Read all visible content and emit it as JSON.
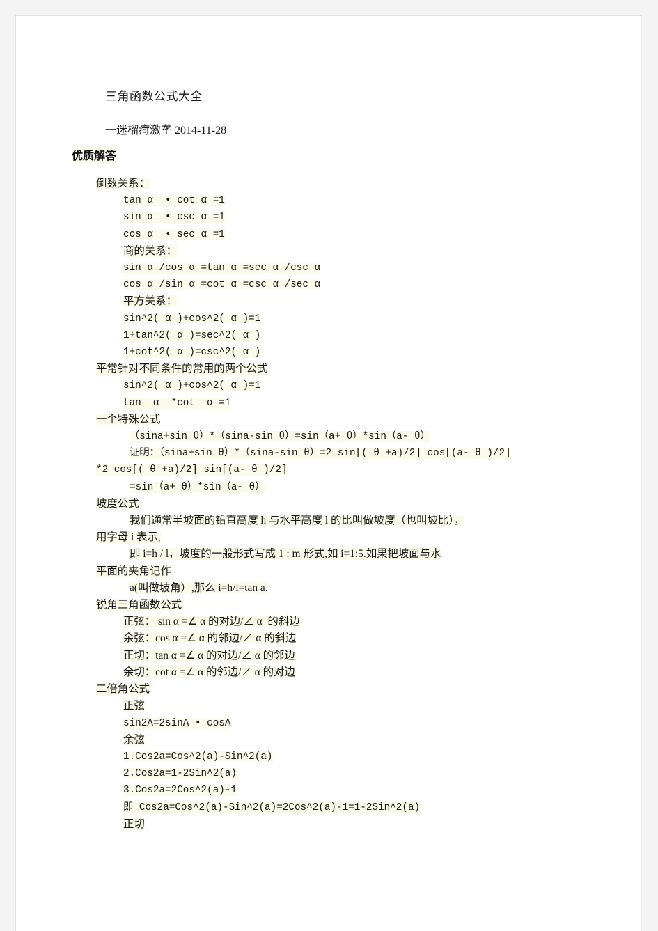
{
  "document": {
    "title": "三角函数公式大全",
    "byline": "一迷榴疴激垄 2014-11-28",
    "answer_heading": "优质解答"
  },
  "content": {
    "lines": [
      {
        "text": "倒数关系：",
        "style": "cjk",
        "indent": 0
      },
      {
        "text": "tan α  • cot α =1",
        "style": "mono",
        "indent": 1
      },
      {
        "text": "sin α  • csc α =1",
        "style": "mono",
        "indent": 1
      },
      {
        "text": "cos α  • sec α =1",
        "style": "mono",
        "indent": 1
      },
      {
        "text": "商的关系：",
        "style": "cjk",
        "indent": 1
      },
      {
        "text": "sin α /cos α =tan α =sec α /csc α",
        "style": "mono",
        "indent": 1
      },
      {
        "text": "cos α /sin α =cot α =csc α /sec α",
        "style": "mono",
        "indent": 1
      },
      {
        "text": "平方关系：",
        "style": "cjk",
        "indent": 1
      },
      {
        "text": "sin^2( α )+cos^2( α )=1",
        "style": "mono",
        "indent": 1
      },
      {
        "text": "1+tan^2( α )=sec^2( α )",
        "style": "mono",
        "indent": 1
      },
      {
        "text": "1+cot^2( α )=csc^2( α )",
        "style": "mono",
        "indent": 1
      },
      {
        "text": "平常针对不同条件的常用的两个公式",
        "style": "cjk",
        "indent": 0
      },
      {
        "text": "sin^2( α )+cos^2( α )=1",
        "style": "mono",
        "indent": 1
      },
      {
        "text": "tan  α  *cot  α =1",
        "style": "mono",
        "indent": 1
      },
      {
        "text": "一个特殊公式",
        "style": "cjk",
        "indent": 0
      },
      {
        "text": "（sina+sin θ）*（sina-sin θ）=sin（a+ θ）*sin（a- θ）",
        "style": "mono",
        "indent": 2
      },
      {
        "text": "证明：（sina+sin θ）*（sina-sin θ）=2 sin[( θ +a)/2] cos[(a- θ )/2]",
        "style": "mono",
        "indent": 2
      },
      {
        "text": "*2 cos[( θ +a)/2] sin[(a- θ )/2]",
        "style": "mono",
        "indent": 0
      },
      {
        "text": "=sin（a+ θ）*sin（a- θ）",
        "style": "mono",
        "indent": 2
      },
      {
        "text": "坡度公式",
        "style": "cjk",
        "indent": 0
      },
      {
        "text": "我们通常半坡面的铅直高度 h 与水平高度 l 的比叫做坡度（也叫坡比），",
        "style": "cjk",
        "indent": 2
      },
      {
        "text": "用字母 i 表示,",
        "style": "cjk",
        "indent": 0
      },
      {
        "text": "即 i=h / l，坡度的一般形式写成 1 : m 形式,如 i=1:5.如果把坡面与水",
        "style": "cjk",
        "indent": 2
      },
      {
        "text": "平面的夹角记作",
        "style": "cjk",
        "indent": 0
      },
      {
        "text": "a(叫做坡角）,那么 i=h/l=tan a.",
        "style": "cjk",
        "indent": 2
      },
      {
        "text": "锐角三角函数公式",
        "style": "cjk",
        "indent": 0
      },
      {
        "text": "正弦： sin α =∠ α 的对边/∠ α  的斜边",
        "style": "cjk",
        "indent": 1
      },
      {
        "text": "余弦：cos α =∠ α 的邻边/∠ α 的斜边",
        "style": "cjk",
        "indent": 1
      },
      {
        "text": "正切：tan α =∠ α 的对边/∠ α 的邻边",
        "style": "cjk",
        "indent": 1
      },
      {
        "text": "余切：cot α =∠ α 的邻边/∠ α 的对边",
        "style": "cjk",
        "indent": 1
      },
      {
        "text": "二倍角公式",
        "style": "cjk",
        "indent": 0
      },
      {
        "text": "正弦",
        "style": "cjk",
        "indent": 1
      },
      {
        "text": "sin2A=2sinA • cosA",
        "style": "mono",
        "indent": 1
      },
      {
        "text": "余弦",
        "style": "cjk",
        "indent": 1
      },
      {
        "text": "1.Cos2a=Cos^2(a)-Sin^2(a)",
        "style": "mono",
        "indent": 1
      },
      {
        "text": "2.Cos2a=1-2Sin^2(a)",
        "style": "mono",
        "indent": 1
      },
      {
        "text": "3.Cos2a=2Cos^2(a)-1",
        "style": "mono",
        "indent": 1
      },
      {
        "text": "即 Cos2a=Cos^2(a)-Sin^2(a)=2Cos^2(a)-1=1-2Sin^2(a)",
        "style": "mono",
        "indent": 1
      },
      {
        "text": "正切",
        "style": "cjk",
        "indent": 1
      }
    ]
  },
  "colors": {
    "page_background": "#f4f4f4",
    "sheet": "#ffffff",
    "highlight": "#fbfbec",
    "text": "#161616"
  }
}
